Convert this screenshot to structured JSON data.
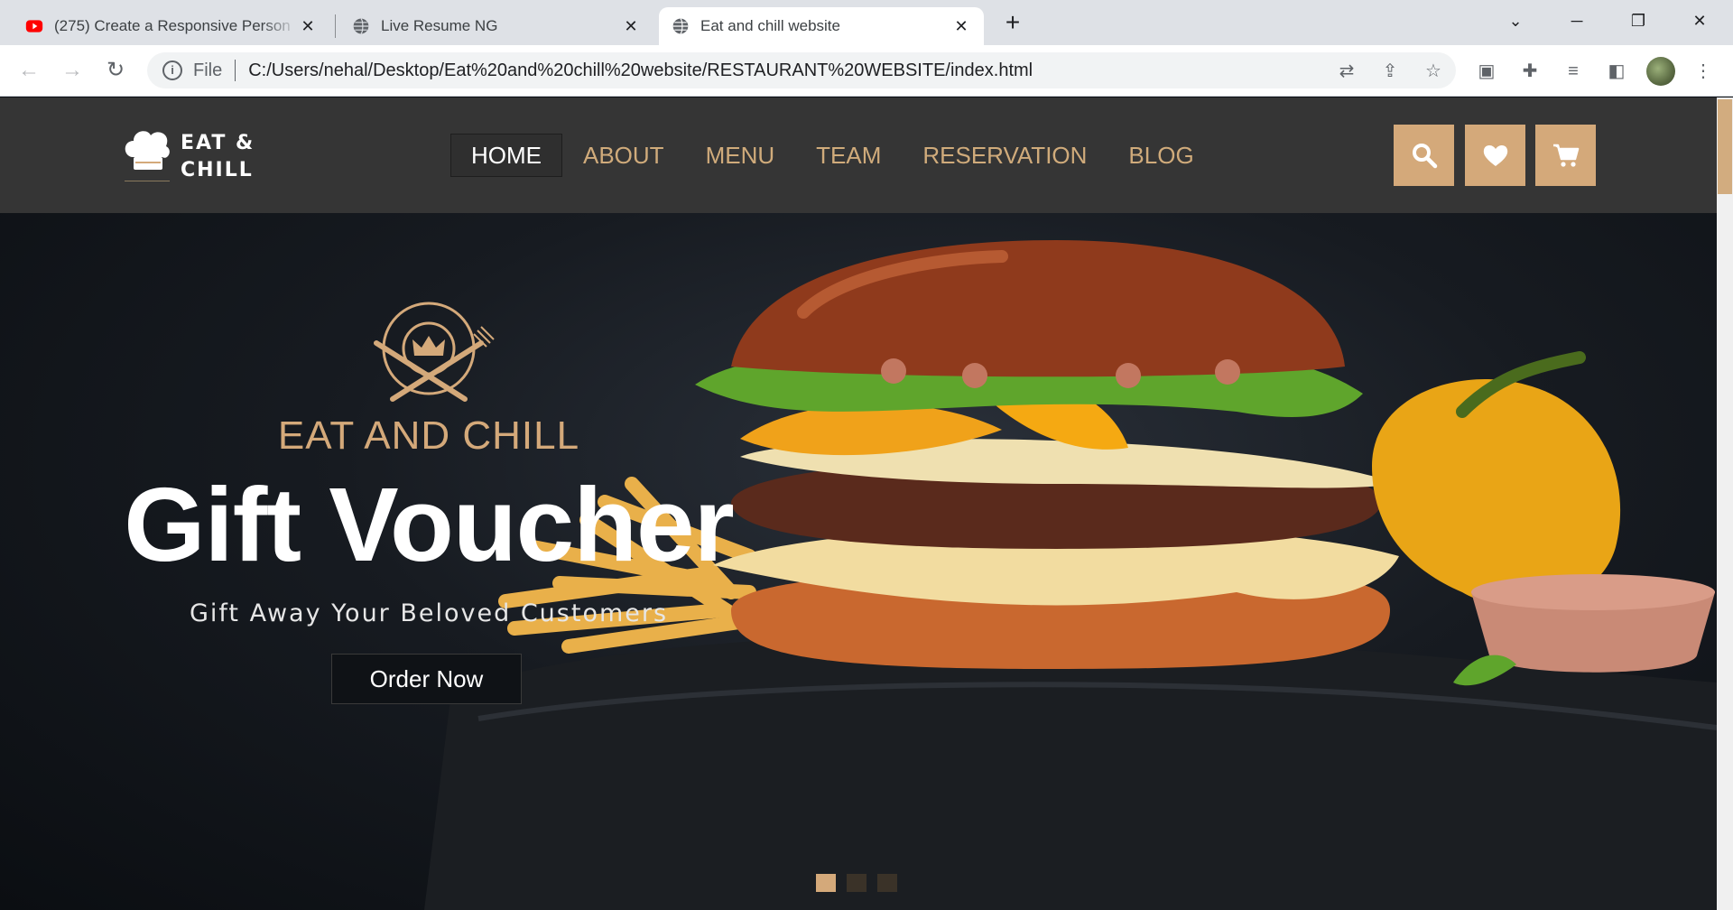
{
  "browser": {
    "tabs": [
      {
        "title": "(275) Create a Responsive Person",
        "favicon": "youtube-icon",
        "active": false
      },
      {
        "title": "Live Resume NG",
        "favicon": "globe-icon",
        "active": false
      },
      {
        "title": "Eat and chill website",
        "favicon": "globe-icon",
        "active": true
      }
    ],
    "new_tab": "+",
    "scheme_label": "File",
    "url": "C:/Users/nehal/Desktop/Eat%20and%20chill%20website/RESTAURANT%20WEBSITE/index.html"
  },
  "site": {
    "logo": {
      "line1": "EAT &",
      "line2": "CHILL"
    },
    "nav": [
      {
        "label": "HOME",
        "active": true
      },
      {
        "label": "ABOUT",
        "active": false
      },
      {
        "label": "MENU",
        "active": false
      },
      {
        "label": "TEAM",
        "active": false
      },
      {
        "label": "RESERVATION",
        "active": false
      },
      {
        "label": "BLOG",
        "active": false
      }
    ],
    "header_icons": [
      "search-icon",
      "heart-icon",
      "cart-icon"
    ],
    "colors": {
      "accent": "#d4a97a",
      "header_bg": "#353535",
      "hero_bg": "#0d1116"
    }
  },
  "hero": {
    "kicker": "EAT AND CHILL",
    "title": "Gift Voucher",
    "subtitle": "Gift Away Your Beloved Customers",
    "button": "Order Now",
    "slides": {
      "count": 3,
      "active": 1
    }
  }
}
